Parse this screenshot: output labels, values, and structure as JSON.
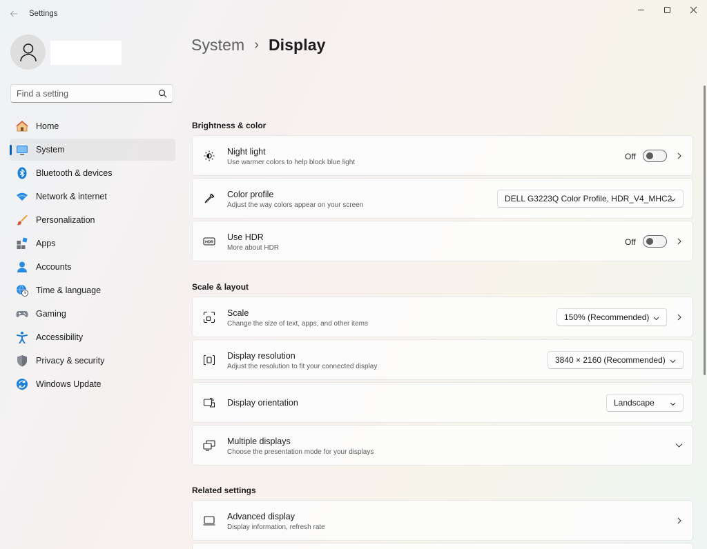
{
  "window": {
    "app_title": "Settings"
  },
  "sidebar": {
    "search_placeholder": "Find a setting",
    "items": [
      {
        "label": "Home",
        "icon": "home-icon",
        "active": false
      },
      {
        "label": "System",
        "icon": "system-icon",
        "active": true
      },
      {
        "label": "Bluetooth & devices",
        "icon": "bluetooth-icon",
        "active": false
      },
      {
        "label": "Network & internet",
        "icon": "wifi-icon",
        "active": false
      },
      {
        "label": "Personalization",
        "icon": "brush-icon",
        "active": false
      },
      {
        "label": "Apps",
        "icon": "apps-icon",
        "active": false
      },
      {
        "label": "Accounts",
        "icon": "accounts-icon",
        "active": false
      },
      {
        "label": "Time & language",
        "icon": "globe-clock-icon",
        "active": false
      },
      {
        "label": "Gaming",
        "icon": "gamepad-icon",
        "active": false
      },
      {
        "label": "Accessibility",
        "icon": "accessibility-icon",
        "active": false
      },
      {
        "label": "Privacy & security",
        "icon": "shield-icon",
        "active": false
      },
      {
        "label": "Windows Update",
        "icon": "update-icon",
        "active": false
      }
    ]
  },
  "breadcrumb": {
    "parent": "System",
    "separator": "›",
    "current": "Display"
  },
  "sections": {
    "brightness": {
      "title": "Brightness & color",
      "night_light": {
        "title": "Night light",
        "subtitle": "Use warmer colors to help block blue light",
        "state": "Off"
      },
      "color_profile": {
        "title": "Color profile",
        "subtitle": "Adjust the way colors appear on your screen",
        "value": "DELL G3223Q Color Profile, HDR_V4_MHC2"
      },
      "hdr": {
        "title": "Use HDR",
        "subtitle": "More about HDR",
        "state": "Off"
      }
    },
    "scale_layout": {
      "title": "Scale & layout",
      "scale": {
        "title": "Scale",
        "subtitle": "Change the size of text, apps, and other items",
        "value": "150% (Recommended)"
      },
      "resolution": {
        "title": "Display resolution",
        "subtitle": "Adjust the resolution to fit your connected display",
        "value": "3840 × 2160 (Recommended)"
      },
      "orientation": {
        "title": "Display orientation",
        "value": "Landscape"
      },
      "multiple": {
        "title": "Multiple displays",
        "subtitle": "Choose the presentation mode for your displays"
      }
    },
    "related": {
      "title": "Related settings",
      "advanced": {
        "title": "Advanced display",
        "subtitle": "Display information, refresh rate"
      }
    }
  },
  "colors": {
    "accent": "#005fb8"
  }
}
